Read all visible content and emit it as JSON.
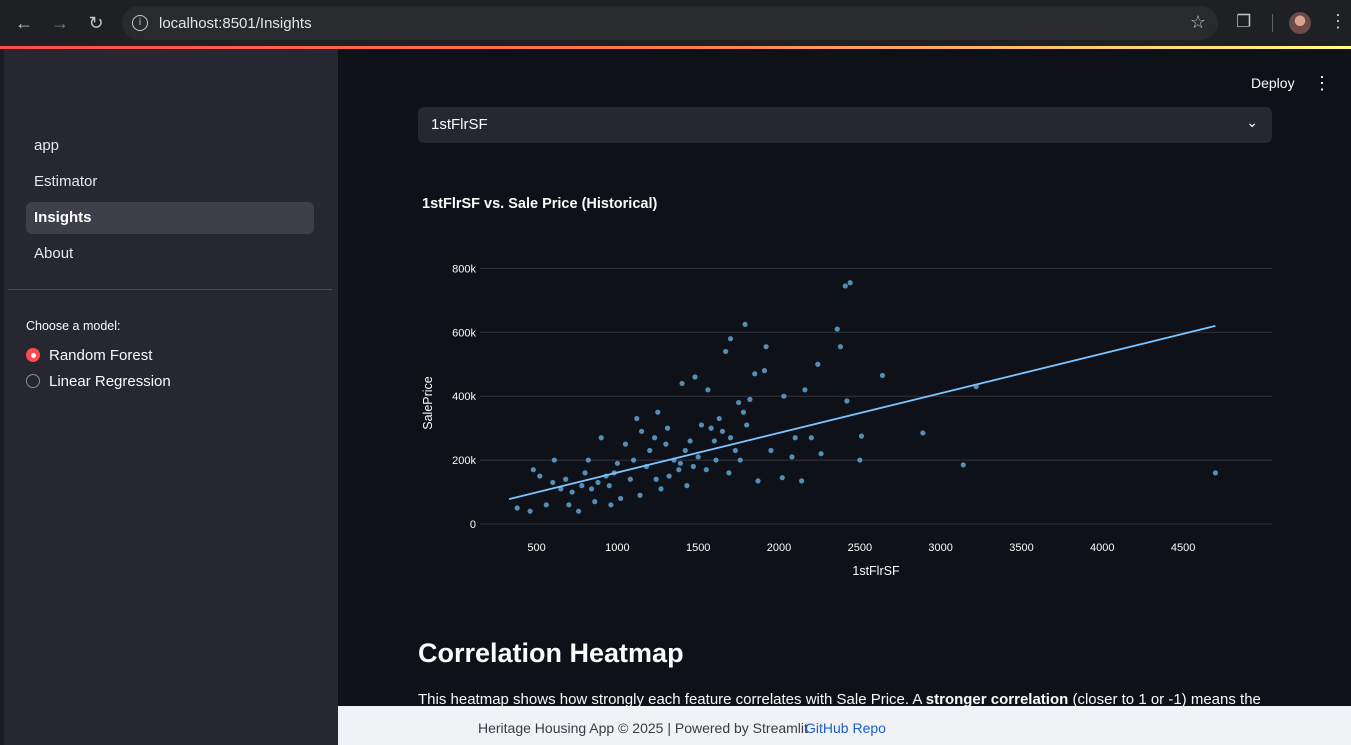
{
  "browser": {
    "url": "localhost:8501/Insights"
  },
  "sidebar": {
    "items": [
      {
        "label": "app",
        "active": false
      },
      {
        "label": "Estimator",
        "active": false
      },
      {
        "label": "Insights",
        "active": true
      },
      {
        "label": "About",
        "active": false
      }
    ],
    "model_label": "Choose a model:",
    "models": [
      {
        "label": "Random Forest",
        "selected": true
      },
      {
        "label": "Linear Regression",
        "selected": false
      }
    ]
  },
  "header": {
    "deploy_label": "Deploy"
  },
  "feature_select": {
    "value": "1stFlrSF"
  },
  "chart_title": "1stFlrSF vs. Sale Price (Historical)",
  "chart_data": {
    "type": "scatter",
    "title": "1stFlrSF vs. Sale Price (Historical)",
    "xlabel": "1stFlrSF",
    "ylabel": "SalePrice",
    "xlim": [
      150,
      5050
    ],
    "ylim": [
      0,
      820000
    ],
    "x_ticks": [
      500,
      1000,
      1500,
      2000,
      2500,
      3000,
      3500,
      4000,
      4500
    ],
    "y_ticks": [
      0,
      200000,
      400000,
      600000,
      800000
    ],
    "y_tick_labels": [
      "0",
      "200k",
      "400k",
      "600k",
      "800k"
    ],
    "grid": true,
    "point_color": "#6bb8ee",
    "line_color": "#7cc4ff",
    "trendline": {
      "x": [
        330,
        4700
      ],
      "y": [
        78000,
        620000
      ]
    },
    "points": [
      [
        2410,
        745000
      ],
      [
        2440,
        755000
      ],
      [
        2360,
        610000
      ],
      [
        2380,
        555000
      ],
      [
        1790,
        625000
      ],
      [
        1700,
        580000
      ],
      [
        1920,
        555000
      ],
      [
        2240,
        500000
      ],
      [
        2640,
        465000
      ],
      [
        3220,
        430000
      ],
      [
        2420,
        385000
      ],
      [
        2510,
        275000
      ],
      [
        2890,
        285000
      ],
      [
        3140,
        185000
      ],
      [
        2500,
        200000
      ],
      [
        4700,
        160000
      ],
      [
        2030,
        400000
      ],
      [
        2160,
        420000
      ],
      [
        1670,
        540000
      ],
      [
        1910,
        480000
      ],
      [
        1850,
        470000
      ],
      [
        2100,
        270000
      ],
      [
        2200,
        270000
      ],
      [
        2080,
        210000
      ],
      [
        2260,
        220000
      ],
      [
        1950,
        230000
      ],
      [
        1870,
        135000
      ],
      [
        2020,
        145000
      ],
      [
        2140,
        135000
      ],
      [
        1400,
        440000
      ],
      [
        1480,
        460000
      ],
      [
        1560,
        420000
      ],
      [
        1250,
        350000
      ],
      [
        1120,
        330000
      ],
      [
        1310,
        300000
      ],
      [
        900,
        270000
      ],
      [
        820,
        200000
      ],
      [
        610,
        200000
      ],
      [
        600,
        130000
      ],
      [
        380,
        50000
      ],
      [
        460,
        40000
      ],
      [
        560,
        60000
      ],
      [
        700,
        60000
      ],
      [
        520,
        150000
      ],
      [
        480,
        170000
      ],
      [
        1750,
        380000
      ],
      [
        1820,
        390000
      ],
      [
        1630,
        330000
      ],
      [
        1780,
        350000
      ],
      [
        1600,
        260000
      ],
      [
        1730,
        230000
      ],
      [
        1690,
        160000
      ],
      [
        1550,
        170000
      ],
      [
        1430,
        120000
      ],
      [
        1270,
        110000
      ],
      [
        1140,
        90000
      ],
      [
        1020,
        80000
      ],
      [
        960,
        60000
      ],
      [
        860,
        70000
      ],
      [
        760,
        40000
      ],
      [
        1300,
        250000
      ],
      [
        1200,
        230000
      ],
      [
        1100,
        200000
      ],
      [
        1050,
        250000
      ],
      [
        980,
        160000
      ],
      [
        930,
        150000
      ],
      [
        880,
        130000
      ],
      [
        840,
        110000
      ],
      [
        800,
        160000
      ],
      [
        1180,
        180000
      ],
      [
        1350,
        200000
      ],
      [
        1420,
        230000
      ],
      [
        1500,
        210000
      ],
      [
        1650,
        290000
      ],
      [
        1580,
        300000
      ],
      [
        1240,
        140000
      ],
      [
        1080,
        140000
      ],
      [
        1000,
        190000
      ],
      [
        950,
        120000
      ],
      [
        780,
        120000
      ],
      [
        720,
        100000
      ],
      [
        680,
        140000
      ],
      [
        650,
        110000
      ],
      [
        1380,
        170000
      ],
      [
        1450,
        260000
      ],
      [
        1520,
        310000
      ],
      [
        1610,
        200000
      ],
      [
        1700,
        270000
      ],
      [
        1760,
        200000
      ],
      [
        1800,
        310000
      ],
      [
        1150,
        290000
      ],
      [
        1230,
        270000
      ],
      [
        1320,
        150000
      ],
      [
        1390,
        190000
      ],
      [
        1470,
        180000
      ]
    ]
  },
  "section": {
    "heading": "Correlation Heatmap",
    "para_1": "This heatmap shows how strongly each feature correlates with Sale Price. A ",
    "para_bold": "stronger correlation",
    "para_2": " (closer to 1 or -1) means the"
  },
  "footer": {
    "text": "Heritage Housing App © 2025 | Powered by Streamlit",
    "link": "GitHub Repo"
  }
}
